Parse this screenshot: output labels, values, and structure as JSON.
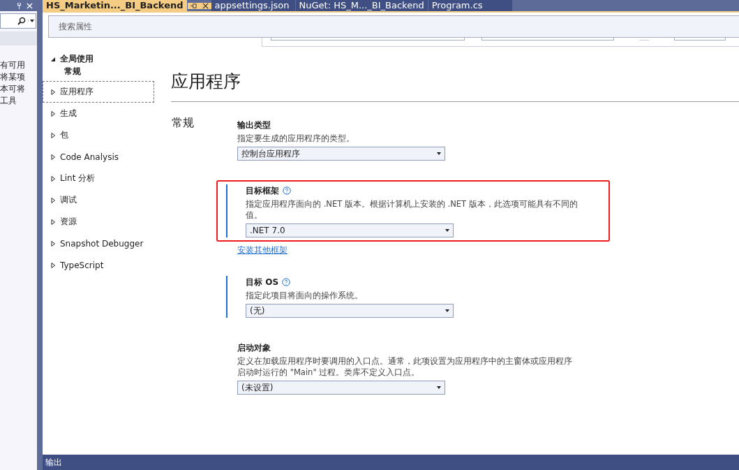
{
  "left_panel": {
    "fragments": [
      "有可用",
      "将某项",
      "本可将",
      "工具"
    ]
  },
  "tabs": [
    {
      "label": "HS_Marketin..._BI_Backend",
      "selected": true
    },
    {
      "label": "appsettings.json",
      "selected": false
    },
    {
      "label": "NuGet: HS_M..._BI_Backend",
      "selected": false
    },
    {
      "label": "Program.cs",
      "selected": false
    }
  ],
  "search": {
    "placeholder": "搜索属性"
  },
  "nav": [
    {
      "label": "全局使用",
      "expanded": true,
      "selected": false,
      "children": [
        {
          "label": "常规",
          "selected": false
        }
      ]
    },
    {
      "label": "应用程序",
      "expanded": false,
      "selected": true
    },
    {
      "label": "生成",
      "expanded": false,
      "selected": false
    },
    {
      "label": "包",
      "expanded": false,
      "selected": false
    },
    {
      "label": "Code Analysis",
      "expanded": false,
      "selected": false
    },
    {
      "label": "Lint 分析",
      "expanded": false,
      "selected": false
    },
    {
      "label": "调试",
      "expanded": false,
      "selected": false
    },
    {
      "label": "资源",
      "expanded": false,
      "selected": false
    },
    {
      "label": "Snapshot Debugger",
      "expanded": false,
      "selected": false
    },
    {
      "label": "TypeScript",
      "expanded": false,
      "selected": false
    }
  ],
  "page_title": "应用程序",
  "section": "常规",
  "settings": [
    {
      "title": "输出类型",
      "description": "指定要生成的应用程序的类型。",
      "value": "控制台应用程序"
    },
    {
      "title": "目标框架",
      "help": true,
      "accent": true,
      "highlighted": true,
      "description": "指定应用程序面向的 .NET 版本。根据计算机上安装的 .NET 版本，此选项可能具有不同的值。",
      "value": ".NET 7.0",
      "link": "安装其他框架"
    },
    {
      "title": "目标 OS",
      "help": true,
      "accent": true,
      "description": "指定此项目将面向的操作系统。",
      "value": "(无)"
    },
    {
      "title": "启动对象",
      "description": "定义在加载应用程序时要调用的入口点。通常，此项设置为应用程序中的主窗体或应用程序启动时运行的 \"Main\" 过程。类库不定义入口点。",
      "value": "(未设置)"
    }
  ],
  "status_bar": {
    "label": "输出"
  }
}
